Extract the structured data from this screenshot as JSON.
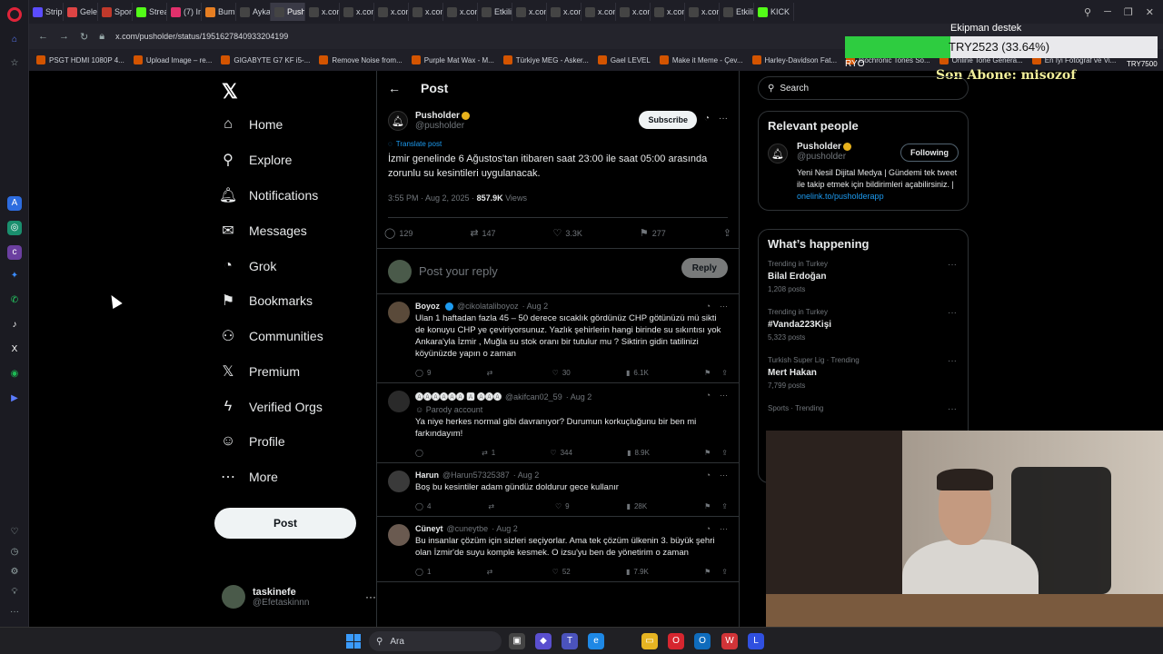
{
  "tabs": [
    {
      "label": "Strip",
      "color": "#5b4cff"
    },
    {
      "label": "Gele",
      "color": "#d44"
    },
    {
      "label": "Spor",
      "color": "#c0392b"
    },
    {
      "label": "Strea",
      "color": "#53fc18"
    },
    {
      "label": "(7) In",
      "color": "#e1306c"
    },
    {
      "label": "Bum",
      "color": "#e67e22"
    },
    {
      "label": "Ayka",
      "color": "#444"
    },
    {
      "label": "Pusholde",
      "color": "#444",
      "active": true
    },
    {
      "label": "x.com",
      "color": "#444"
    },
    {
      "label": "x.com",
      "color": "#444"
    },
    {
      "label": "x.com",
      "color": "#444"
    },
    {
      "label": "x.com",
      "color": "#444"
    },
    {
      "label": "x.com",
      "color": "#444"
    },
    {
      "label": "Etkili",
      "color": "#444"
    },
    {
      "label": "x.com",
      "color": "#444"
    },
    {
      "label": "x.com",
      "color": "#444"
    },
    {
      "label": "x.com",
      "color": "#444"
    },
    {
      "label": "x.com",
      "color": "#444"
    },
    {
      "label": "x.com",
      "color": "#444"
    },
    {
      "label": "x.com",
      "color": "#444"
    },
    {
      "label": "Etkili",
      "color": "#444"
    },
    {
      "label": "KICK",
      "color": "#53fc18"
    }
  ],
  "address": {
    "url": "x.com/pusholder/status/1951627840933204199"
  },
  "bookmarks": [
    "PSGT HDMI 1080P 4...",
    "Upload Image – re...",
    "GIGABYTE G7 KF i5-...",
    "Remove Noise from...",
    "Purple Mat Wax - M...",
    "Türkiye MEG - Asker...",
    "Gael LEVEL",
    "Make it Meme - Çev...",
    "Harley-Davidson Fat...",
    "Isochronic Tones So...",
    "Online Tone Genera...",
    "En İyi Fotoğraf ve Vi..."
  ],
  "overlay": {
    "title": "Ekipman destek",
    "progress_text": "TRY2523 (33.64%)",
    "progress": 0.3364,
    "left_label": "RYO",
    "right_label": "TRY7500",
    "subscriber": "Son Abone: misozof"
  },
  "nav": {
    "logo": "𝕏",
    "items": [
      {
        "label": "Home",
        "icon": "⌂",
        "name": "home"
      },
      {
        "label": "Explore",
        "icon": "⚲",
        "name": "explore"
      },
      {
        "label": "Notifications",
        "icon": "🔔︎",
        "name": "notifications"
      },
      {
        "label": "Messages",
        "icon": "✉",
        "name": "messages"
      },
      {
        "label": "Grok",
        "icon": "◔",
        "name": "grok"
      },
      {
        "label": "Bookmarks",
        "icon": "⚑",
        "name": "bookmarks"
      },
      {
        "label": "Communities",
        "icon": "⚇",
        "name": "communities"
      },
      {
        "label": "Premium",
        "icon": "𝕏",
        "name": "premium"
      },
      {
        "label": "Verified Orgs",
        "icon": "ϟ",
        "name": "verified-orgs"
      },
      {
        "label": "Profile",
        "icon": "☺",
        "name": "profile"
      },
      {
        "label": "More",
        "icon": "⋯",
        "name": "more"
      }
    ],
    "post_button": "Post",
    "me": {
      "name": "taskinefe",
      "handle": "@Efetaskinnn",
      "menu": "···"
    }
  },
  "post_header": {
    "back": "←",
    "title": "Post"
  },
  "main_post": {
    "author": "Pusholder",
    "handle": "@pusholder",
    "subscribe": "Subscribe",
    "translate": "Translate post",
    "text": "İzmir genelinde 6 Ağustos'tan itibaren saat 23:00 ile saat 05:00 arasında zorunlu su kesintileri uygulanacak.",
    "time": "3:55 PM · Aug 2, 2025 · ",
    "views": "857.9K",
    "views_label": " Views",
    "actions": {
      "replies": "129",
      "reposts": "147",
      "likes": "3.3K",
      "bookmarks": "277"
    }
  },
  "reply_box": {
    "placeholder": "Post your reply",
    "button": "Reply"
  },
  "replies": [
    {
      "name": "Boyoz",
      "verified": true,
      "handle": "@cikolataliboyoz",
      "date": "· Aug 2",
      "parody": "",
      "text": "Ulan 1 haftadan fazla 45 – 50 derece sıcaklık gördünüz CHP götünüzü mü sikti de konuyu CHP ye çeviriyorsunuz. Yazlık şehirlerin hangi birinde su sıkıntısı yok Ankara'yla İzmir , Muğla su stok oranı bir tutulur mu ? Siktirin gidin tatilinizi köyünüzde yapın o zaman",
      "replies": "9",
      "reposts": "",
      "likes": "30",
      "views": "6.1K"
    },
    {
      "name": "🅐🅐🅐🅐🅐🅐 🅰 🅐🅐🅐",
      "verified": false,
      "handle": "@akifcan02_59",
      "date": "· Aug 2",
      "parody": "Parody account",
      "text": "Ya niye herkes normal gibi davranıyor? Durumun korkuçluğunu bir ben mi farkındayım!",
      "replies": "",
      "reposts": "1",
      "likes": "344",
      "views": "8.9K"
    },
    {
      "name": "Harun",
      "verified": false,
      "handle": "@Harun57325387",
      "date": "· Aug 2",
      "parody": "",
      "text": "Boş bu kesintiler adam gündüz doldurur gece kullanır",
      "replies": "4",
      "reposts": "",
      "likes": "9",
      "views": "28K"
    },
    {
      "name": "Cüneyt",
      "verified": false,
      "handle": "@cuneytbe",
      "date": "· Aug 2",
      "parody": "",
      "text": "Bu insanlar çözüm için sizleri seçiyorlar. Ama tek çözüm ülkenin 3. büyük şehri olan İzmir'de suyu komple kesmek. O izsu'yu ben de yönetirim o zaman",
      "replies": "1",
      "reposts": "",
      "likes": "52",
      "views": "7.9K"
    }
  ],
  "search": {
    "placeholder": "Search"
  },
  "relevant": {
    "title": "Relevant people",
    "name": "Pusholder",
    "handle": "@pusholder",
    "follow": "Following",
    "bio": "Yeni Nesil Dijital Medya | Gündemi tek tweet ile takip etmek için bildirimleri açabilirsiniz. | ",
    "link": "onelink.to/pusholderapp"
  },
  "happening": {
    "title": "What’s happening",
    "trends": [
      {
        "context": "Trending in Turkey",
        "name": "Bilal Erdoğan",
        "posts": "1,208 posts"
      },
      {
        "context": "Trending in Turkey",
        "name": "#Vanda223Kişi",
        "posts": "5,323 posts"
      },
      {
        "context": "Turkish Super Lig · Trending",
        "name": "Mert Hakan",
        "posts": "7,799 posts"
      },
      {
        "context": "Sports · Trending",
        "name": "",
        "posts": ""
      }
    ]
  },
  "taskbar": {
    "search": "Ara"
  }
}
